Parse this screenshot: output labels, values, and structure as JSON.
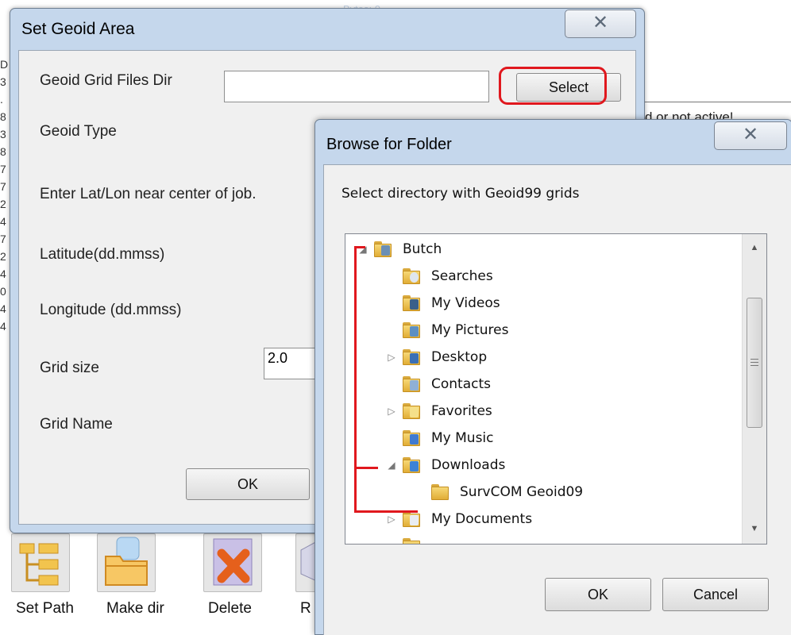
{
  "background": {
    "toolbar": [
      {
        "label": "Set Path"
      },
      {
        "label": "Make dir"
      },
      {
        "label": "Delete"
      },
      {
        "label": "R"
      }
    ],
    "partial_text": "d or not active!"
  },
  "geoid_dialog": {
    "title": "Set Geoid Area",
    "close_glyph": "✕",
    "fields": {
      "grid_dir_label": "Geoid Grid Files Dir",
      "grid_dir_value": "",
      "geoid_type_label": "Geoid Type",
      "instruction": "Enter Lat/Lon near center of job.",
      "latitude_label": "Latitude(dd.mmss)",
      "longitude_label": "Longitude (dd.mmss)",
      "grid_size_label": "Grid size",
      "grid_size_value": "2.0",
      "grid_name_label": "Grid Name"
    },
    "select_button": "Select",
    "ok_button": "OK"
  },
  "browse_dialog": {
    "title": "Browse for Folder",
    "close_glyph": "✕",
    "instruction": "Select directory with Geoid99 grids",
    "tree": [
      {
        "label": "Butch",
        "expander": "◢",
        "icon": "user-folder-icon"
      },
      {
        "label": "Searches",
        "expander": "",
        "icon": "searches-folder-icon"
      },
      {
        "label": "My Videos",
        "expander": "",
        "icon": "videos-folder-icon"
      },
      {
        "label": "My Pictures",
        "expander": "",
        "icon": "pictures-folder-icon"
      },
      {
        "label": "Desktop",
        "expander": "▷",
        "icon": "desktop-folder-icon"
      },
      {
        "label": "Contacts",
        "expander": "",
        "icon": "contacts-folder-icon"
      },
      {
        "label": "Favorites",
        "expander": "▷",
        "icon": "favorites-folder-icon"
      },
      {
        "label": "My Music",
        "expander": "",
        "icon": "music-folder-icon"
      },
      {
        "label": "Downloads",
        "expander": "◢",
        "icon": "downloads-folder-icon"
      },
      {
        "label": "SurvCOM Geoid09",
        "expander": "",
        "icon": "folder-icon"
      },
      {
        "label": "My Documents",
        "expander": "▷",
        "icon": "documents-folder-icon"
      }
    ],
    "ok_button": "OK",
    "cancel_button": "Cancel"
  },
  "colors": {
    "highlight_red": "#e0181e",
    "window_frame": "#c5d7ec",
    "folder_yellow": "#f0c24f"
  }
}
